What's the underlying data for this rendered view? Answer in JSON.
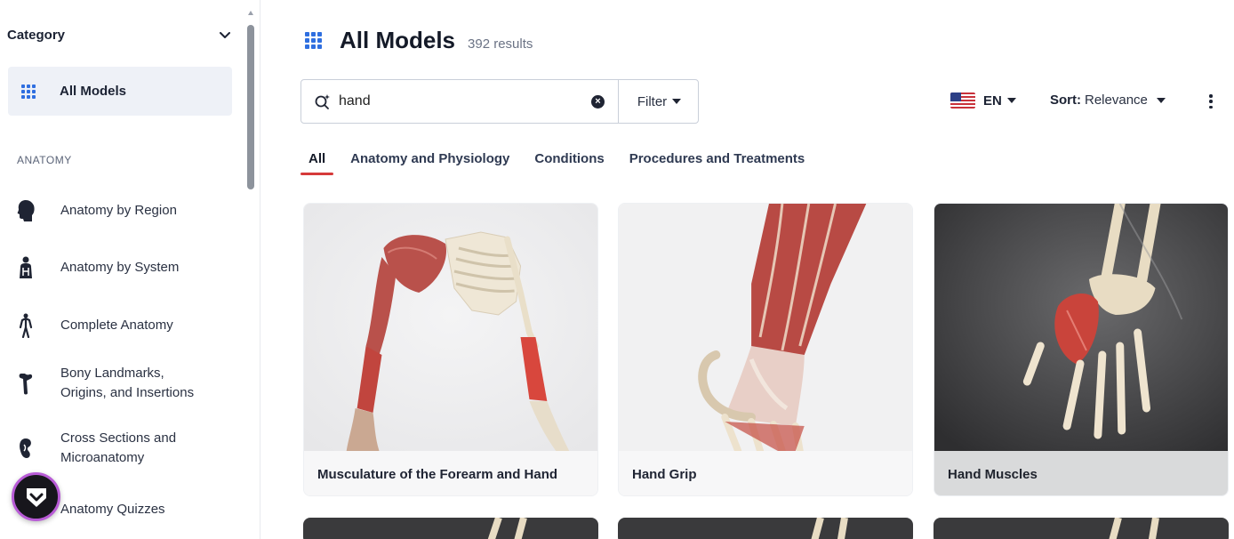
{
  "sidebar": {
    "category_title": "Category",
    "all_models_label": "All Models",
    "section_label": "ANATOMY",
    "items": [
      {
        "label_line1": "Anatomy by Region",
        "label_line2": "",
        "icon": "head-silhouette-icon"
      },
      {
        "label_line1": "Anatomy by System",
        "label_line2": "",
        "icon": "torso-systems-icon"
      },
      {
        "label_line1": "Complete Anatomy",
        "label_line2": "",
        "icon": "human-figure-icon"
      },
      {
        "label_line1": "Bony Landmarks,",
        "label_line2": "Origins, and Insertions",
        "icon": "bone-icon"
      },
      {
        "label_line1": "Cross Sections and",
        "label_line2": "Microanatomy",
        "icon": "kidney-icon"
      },
      {
        "label_line1": "Anatomy Quizzes",
        "label_line2": "",
        "icon": "quiz-icon"
      }
    ]
  },
  "header": {
    "title": "All Models",
    "result_count": "392 results"
  },
  "search": {
    "value": "hand",
    "filter_label": "Filter"
  },
  "toolbar": {
    "language_code": "EN",
    "sort_key": "Sort:",
    "sort_value": "Relevance"
  },
  "tabs": [
    {
      "label": "All",
      "active": true
    },
    {
      "label": "Anatomy and Physiology",
      "active": false
    },
    {
      "label": "Conditions",
      "active": false
    },
    {
      "label": "Procedures and Treatments",
      "active": false
    }
  ],
  "cards": [
    {
      "title": "Musculature of the Forearm and Hand",
      "theme": "light"
    },
    {
      "title": "Hand Grip",
      "theme": "light"
    },
    {
      "title": "Hand Muscles",
      "theme": "dark"
    }
  ],
  "colors": {
    "accent_blue": "#2f6fe0",
    "active_tab_underline": "#d63a3a",
    "muscle_red": "#c9443b"
  }
}
